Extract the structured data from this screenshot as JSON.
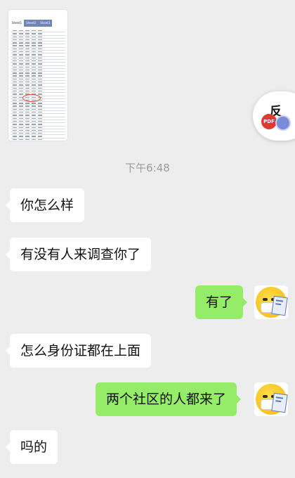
{
  "timestamp": "下午6:48",
  "shared_file": {
    "tabs": [
      "Sheet1",
      "Sheet2",
      "Sheet3"
    ]
  },
  "messages": [
    {
      "side": "left",
      "text": "你怎么样"
    },
    {
      "side": "left",
      "text": "有没有人来调查你了"
    },
    {
      "side": "right",
      "text": "有了"
    },
    {
      "side": "left",
      "text": "怎么身份证都在上面"
    },
    {
      "side": "right",
      "text": "两个社区的人都来了"
    },
    {
      "side": "left",
      "text": "吗的"
    }
  ],
  "floating_widget": {
    "char": "反",
    "badge_label": "PDF"
  },
  "colors": {
    "background": "#ededed",
    "incoming_bubble": "#ffffff",
    "outgoing_bubble": "#95ec69",
    "timestamp": "#9b9b9b"
  }
}
